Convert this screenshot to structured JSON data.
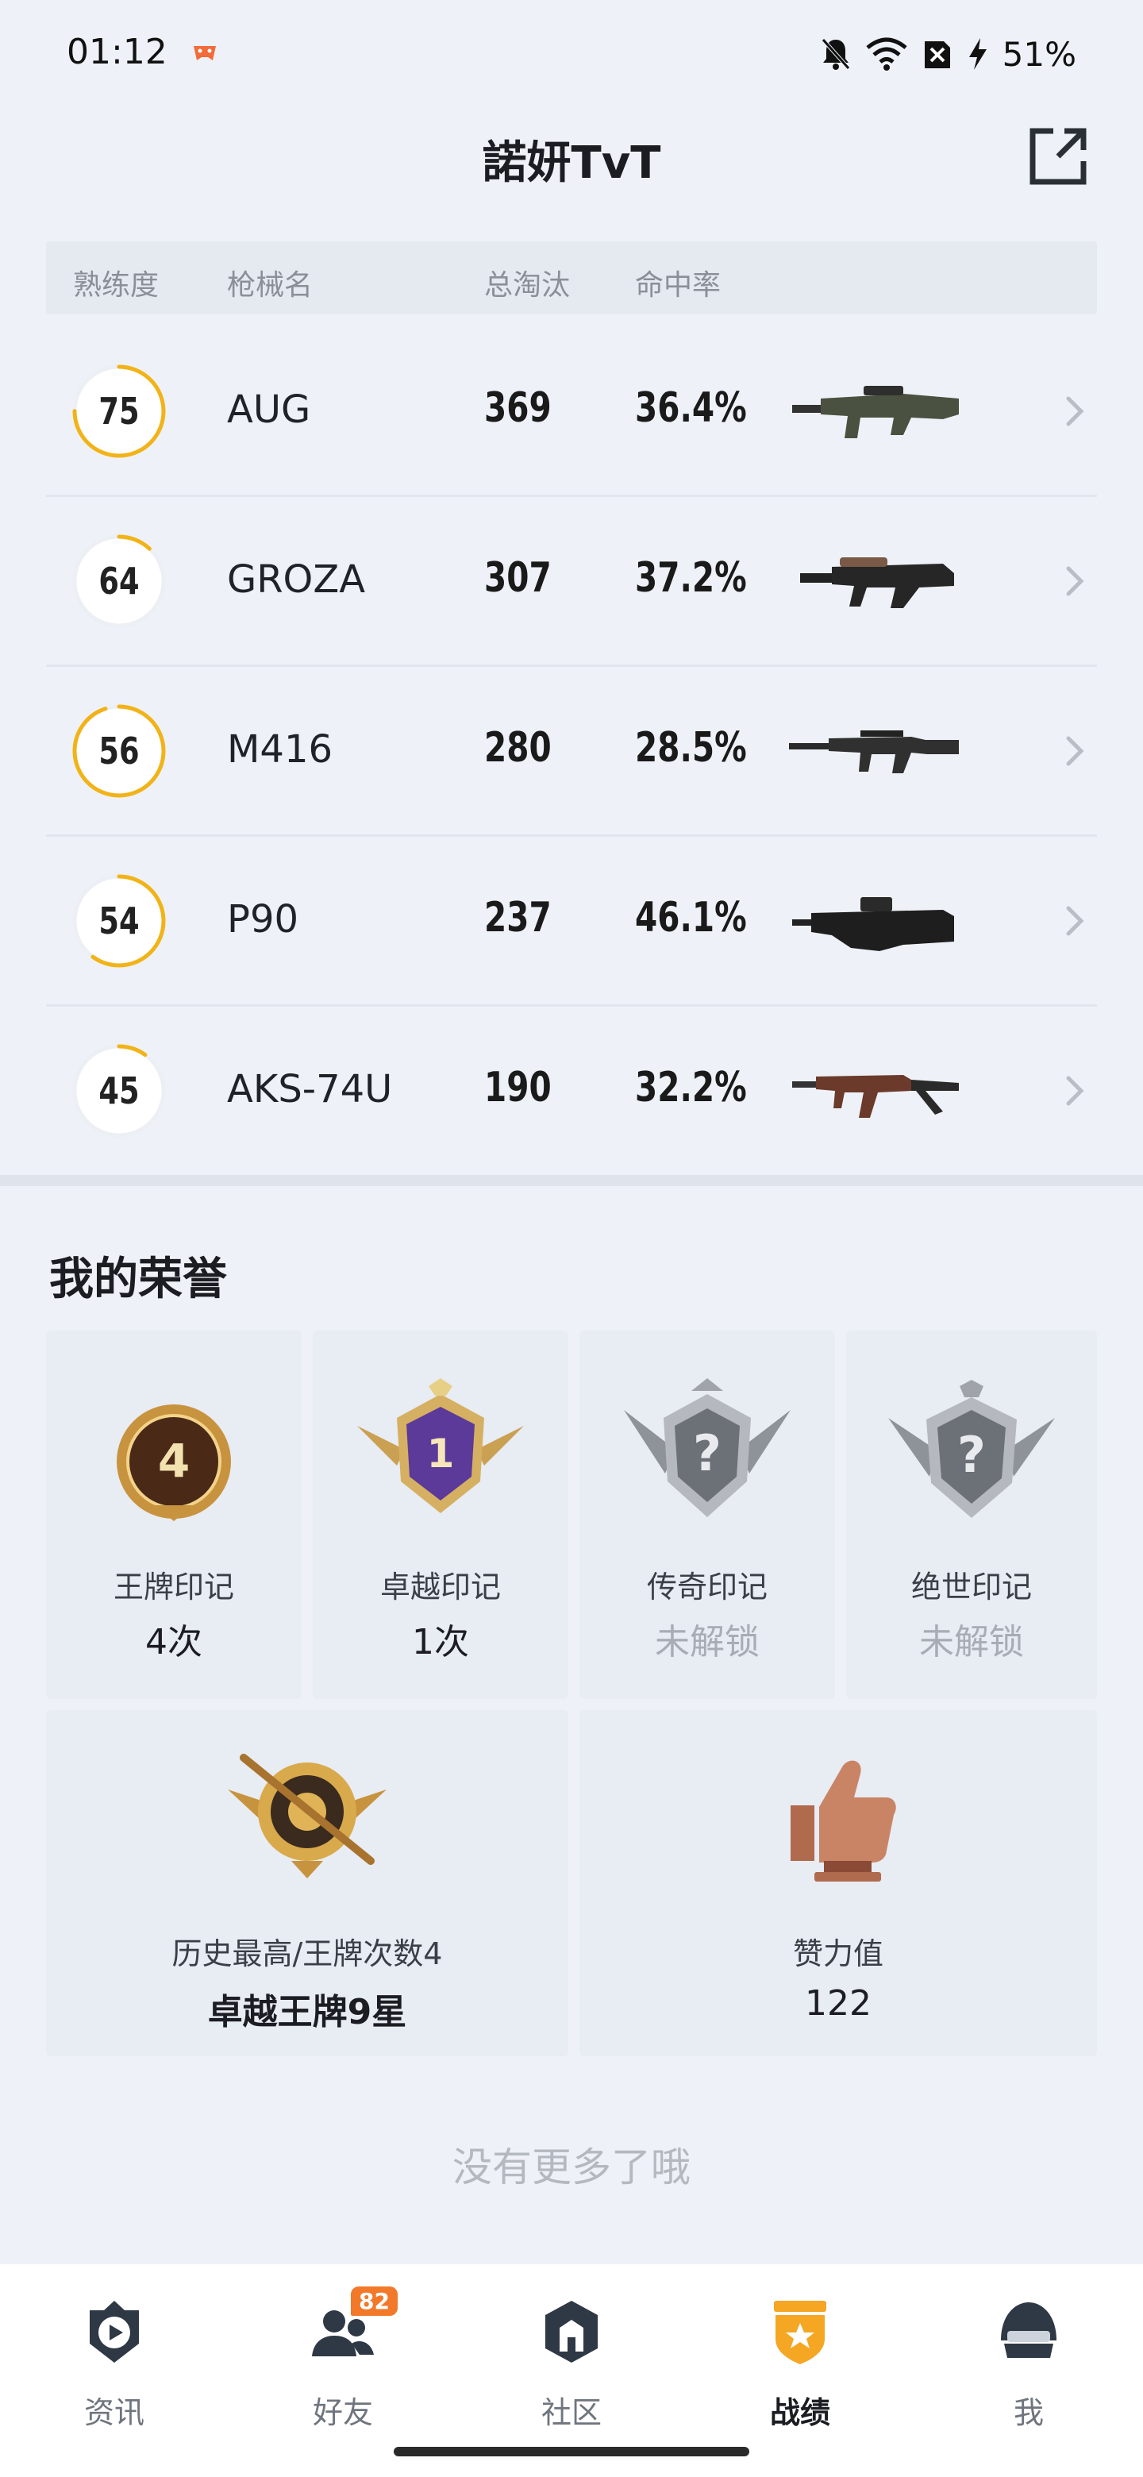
{
  "status_bar": {
    "time": "01:12",
    "battery": "51%"
  },
  "header": {
    "title": "諾妍TvT"
  },
  "weapon_table": {
    "columns": [
      "熟练度",
      "枪械名",
      "总淘汰",
      "命中率"
    ],
    "rows": [
      {
        "mastery": 75,
        "mastery_fraction": 0.75,
        "name": "AUG",
        "eliminations": "369",
        "accuracy": "36.4%",
        "weapon_icon": "aug-rifle-icon"
      },
      {
        "mastery": 64,
        "mastery_fraction": 0.12,
        "name": "GROZA",
        "eliminations": "307",
        "accuracy": "37.2%",
        "weapon_icon": "groza-rifle-icon"
      },
      {
        "mastery": 56,
        "mastery_fraction": 0.95,
        "name": "M416",
        "eliminations": "280",
        "accuracy": "28.5%",
        "weapon_icon": "m416-rifle-icon"
      },
      {
        "mastery": 54,
        "mastery_fraction": 0.6,
        "name": "P90",
        "eliminations": "237",
        "accuracy": "46.1%",
        "weapon_icon": "p90-smg-icon"
      },
      {
        "mastery": 45,
        "mastery_fraction": 0.1,
        "name": "AKS-74U",
        "eliminations": "190",
        "accuracy": "32.2%",
        "weapon_icon": "aks74u-rifle-icon"
      }
    ]
  },
  "honor": {
    "title": "我的荣誉",
    "cards": [
      {
        "label": "王牌印记",
        "value": "4次",
        "icon": "ace-mark-4-icon",
        "locked": false
      },
      {
        "label": "卓越印记",
        "value": "1次",
        "icon": "excellence-mark-1-icon",
        "locked": false
      },
      {
        "label": "传奇印记",
        "value": "未解锁",
        "icon": "legend-mark-locked-icon",
        "locked": true
      },
      {
        "label": "绝世印记",
        "value": "未解锁",
        "icon": "peerless-mark-locked-icon",
        "locked": true
      }
    ],
    "wide_cards": [
      {
        "label": "历史最高/王牌次数4",
        "value": "卓越王牌9星",
        "icon": "rank-emblem-icon"
      },
      {
        "label": "赞力值",
        "value": "122",
        "icon": "thumbs-up-trophy-icon"
      }
    ]
  },
  "end_text": "没有更多了哦",
  "tabbar": {
    "tabs": [
      {
        "label": "资讯",
        "icon": "news-play-icon",
        "active": false
      },
      {
        "label": "好友",
        "icon": "friends-icon",
        "active": false,
        "badge": "82"
      },
      {
        "label": "社区",
        "icon": "community-icon",
        "active": false
      },
      {
        "label": "战绩",
        "icon": "record-shield-icon",
        "active": true
      },
      {
        "label": "我",
        "icon": "helmet-icon",
        "active": false
      }
    ]
  },
  "colors": {
    "accent_ring": "#f2b318",
    "tab_active": "#f5a623",
    "badge": "#f2792a"
  }
}
